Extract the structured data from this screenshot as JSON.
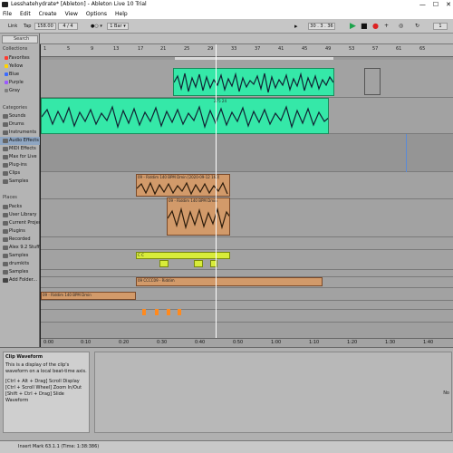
{
  "window": {
    "title": "Lesshatehydrate* [Ableton] - Ableton Live 10 Trial",
    "controls": [
      "—",
      "☐",
      "✕"
    ]
  },
  "menu": [
    "File",
    "Edit",
    "Create",
    "View",
    "Options",
    "Help"
  ],
  "transport": {
    "link": "Link",
    "tap": "Tap",
    "tempo": "158.00",
    "signature": "4 / 4",
    "metronome": "●○ ▾",
    "quantize": "1 Bar ▾",
    "position": "30 . 3 . 36",
    "loop_len": "1"
  },
  "browser": {
    "search": "Search",
    "collections_title": "Collections",
    "collections": [
      {
        "label": "Favorites",
        "color": "#ff3b30"
      },
      {
        "label": "Yellow",
        "color": "#ffd400"
      },
      {
        "label": "Blue",
        "color": "#3a6cff"
      },
      {
        "label": "Purple",
        "color": "#9b59ff"
      },
      {
        "label": "Gray",
        "color": "#808080"
      }
    ],
    "categories_title": "Categories",
    "categories": [
      "Sounds",
      "Drums",
      "Instruments",
      "Audio Effects",
      "MIDI Effects",
      "Max for Live",
      "Plug-ins",
      "Clips",
      "Samples"
    ],
    "places_title": "Places",
    "places": [
      "Packs",
      "User Library",
      "Current Project",
      "Plugins",
      "Recorded",
      "Alex 9.2 Stuff",
      "Samples",
      "drumkits",
      "Samples",
      "Add Folder..."
    ]
  },
  "ruler": [
    "1",
    "5",
    "9",
    "13",
    "17",
    "21",
    "25",
    "29",
    "33",
    "37",
    "41",
    "45",
    "49",
    "53",
    "57",
    "61",
    "65"
  ],
  "timeline": [
    "0:00",
    "0:10",
    "0:20",
    "0:30",
    "0:40",
    "0:50",
    "1:00",
    "1:10",
    "1:20",
    "1:30",
    "1:40"
  ],
  "clips": {
    "riddim1": "09 - Riddim 140 BPM Dmin [2020-09-12 160]",
    "riddim2": "09 - Riddim 140 BPM Dmin",
    "riddim3": "09 - Riddim 140 BPM Dmin",
    "cccc_row": "09 CCCC09 - Riddim",
    "yellow_label": "C C",
    "green_label": "275 24"
  },
  "info": {
    "title": "Clip Waveform",
    "desc": "This is a display of the clip's waveform on a local beat-time axis.",
    "hint1": "[Ctrl + Alt + Drag] Scroll Display",
    "hint2": "[Ctrl + Scroll Wheel] Zoom In/Out",
    "hint3": "[Shift + Ctrl + Drag] Slide Waveform",
    "right_text": "No"
  },
  "status": "Insert Mark 63.1.1 (Time: 1:38:386)",
  "colors": {
    "green": "#35e8a8",
    "brown": "#d29a6a",
    "yellow": "#d8ec3a",
    "orange": "#ff8a1e"
  }
}
